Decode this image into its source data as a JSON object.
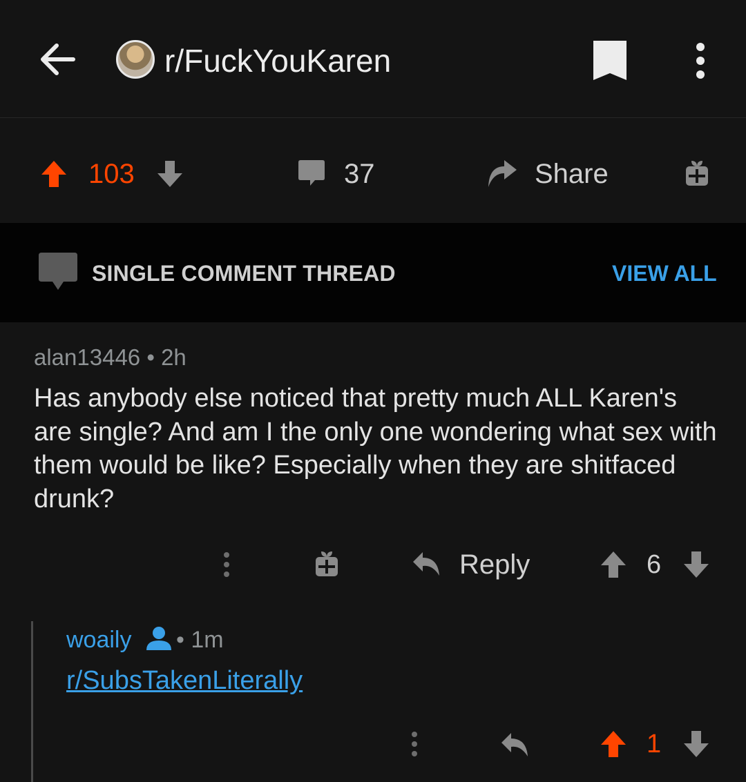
{
  "colors": {
    "upvote": "#ff4500",
    "link": "#3aa0e8",
    "background": "#141414",
    "thread_bar": "#030303"
  },
  "header": {
    "subreddit": "r/FuckYouKaren",
    "icons": [
      "back-arrow-icon",
      "subreddit-avatar",
      "bookmark-icon",
      "kebab-menu-icon"
    ]
  },
  "post_actions": {
    "score": "103",
    "comments": "37",
    "share_label": "Share"
  },
  "thread_bar": {
    "label": "SINGLE COMMENT THREAD",
    "view_all": "VIEW ALL"
  },
  "comment": {
    "author": "alan13446",
    "age": "2h",
    "separator": "•",
    "body": "Has anybody else noticed that pretty much ALL Karen's are single? And am I the only one wondering what sex with them would be like? Especially when they are shitfaced drunk?",
    "reply_label": "Reply",
    "score": "6"
  },
  "reply": {
    "author": "woaily",
    "age": "1m",
    "separator": "•",
    "body_link": "r/SubsTakenLiterally",
    "score": "1",
    "upvoted": true
  }
}
